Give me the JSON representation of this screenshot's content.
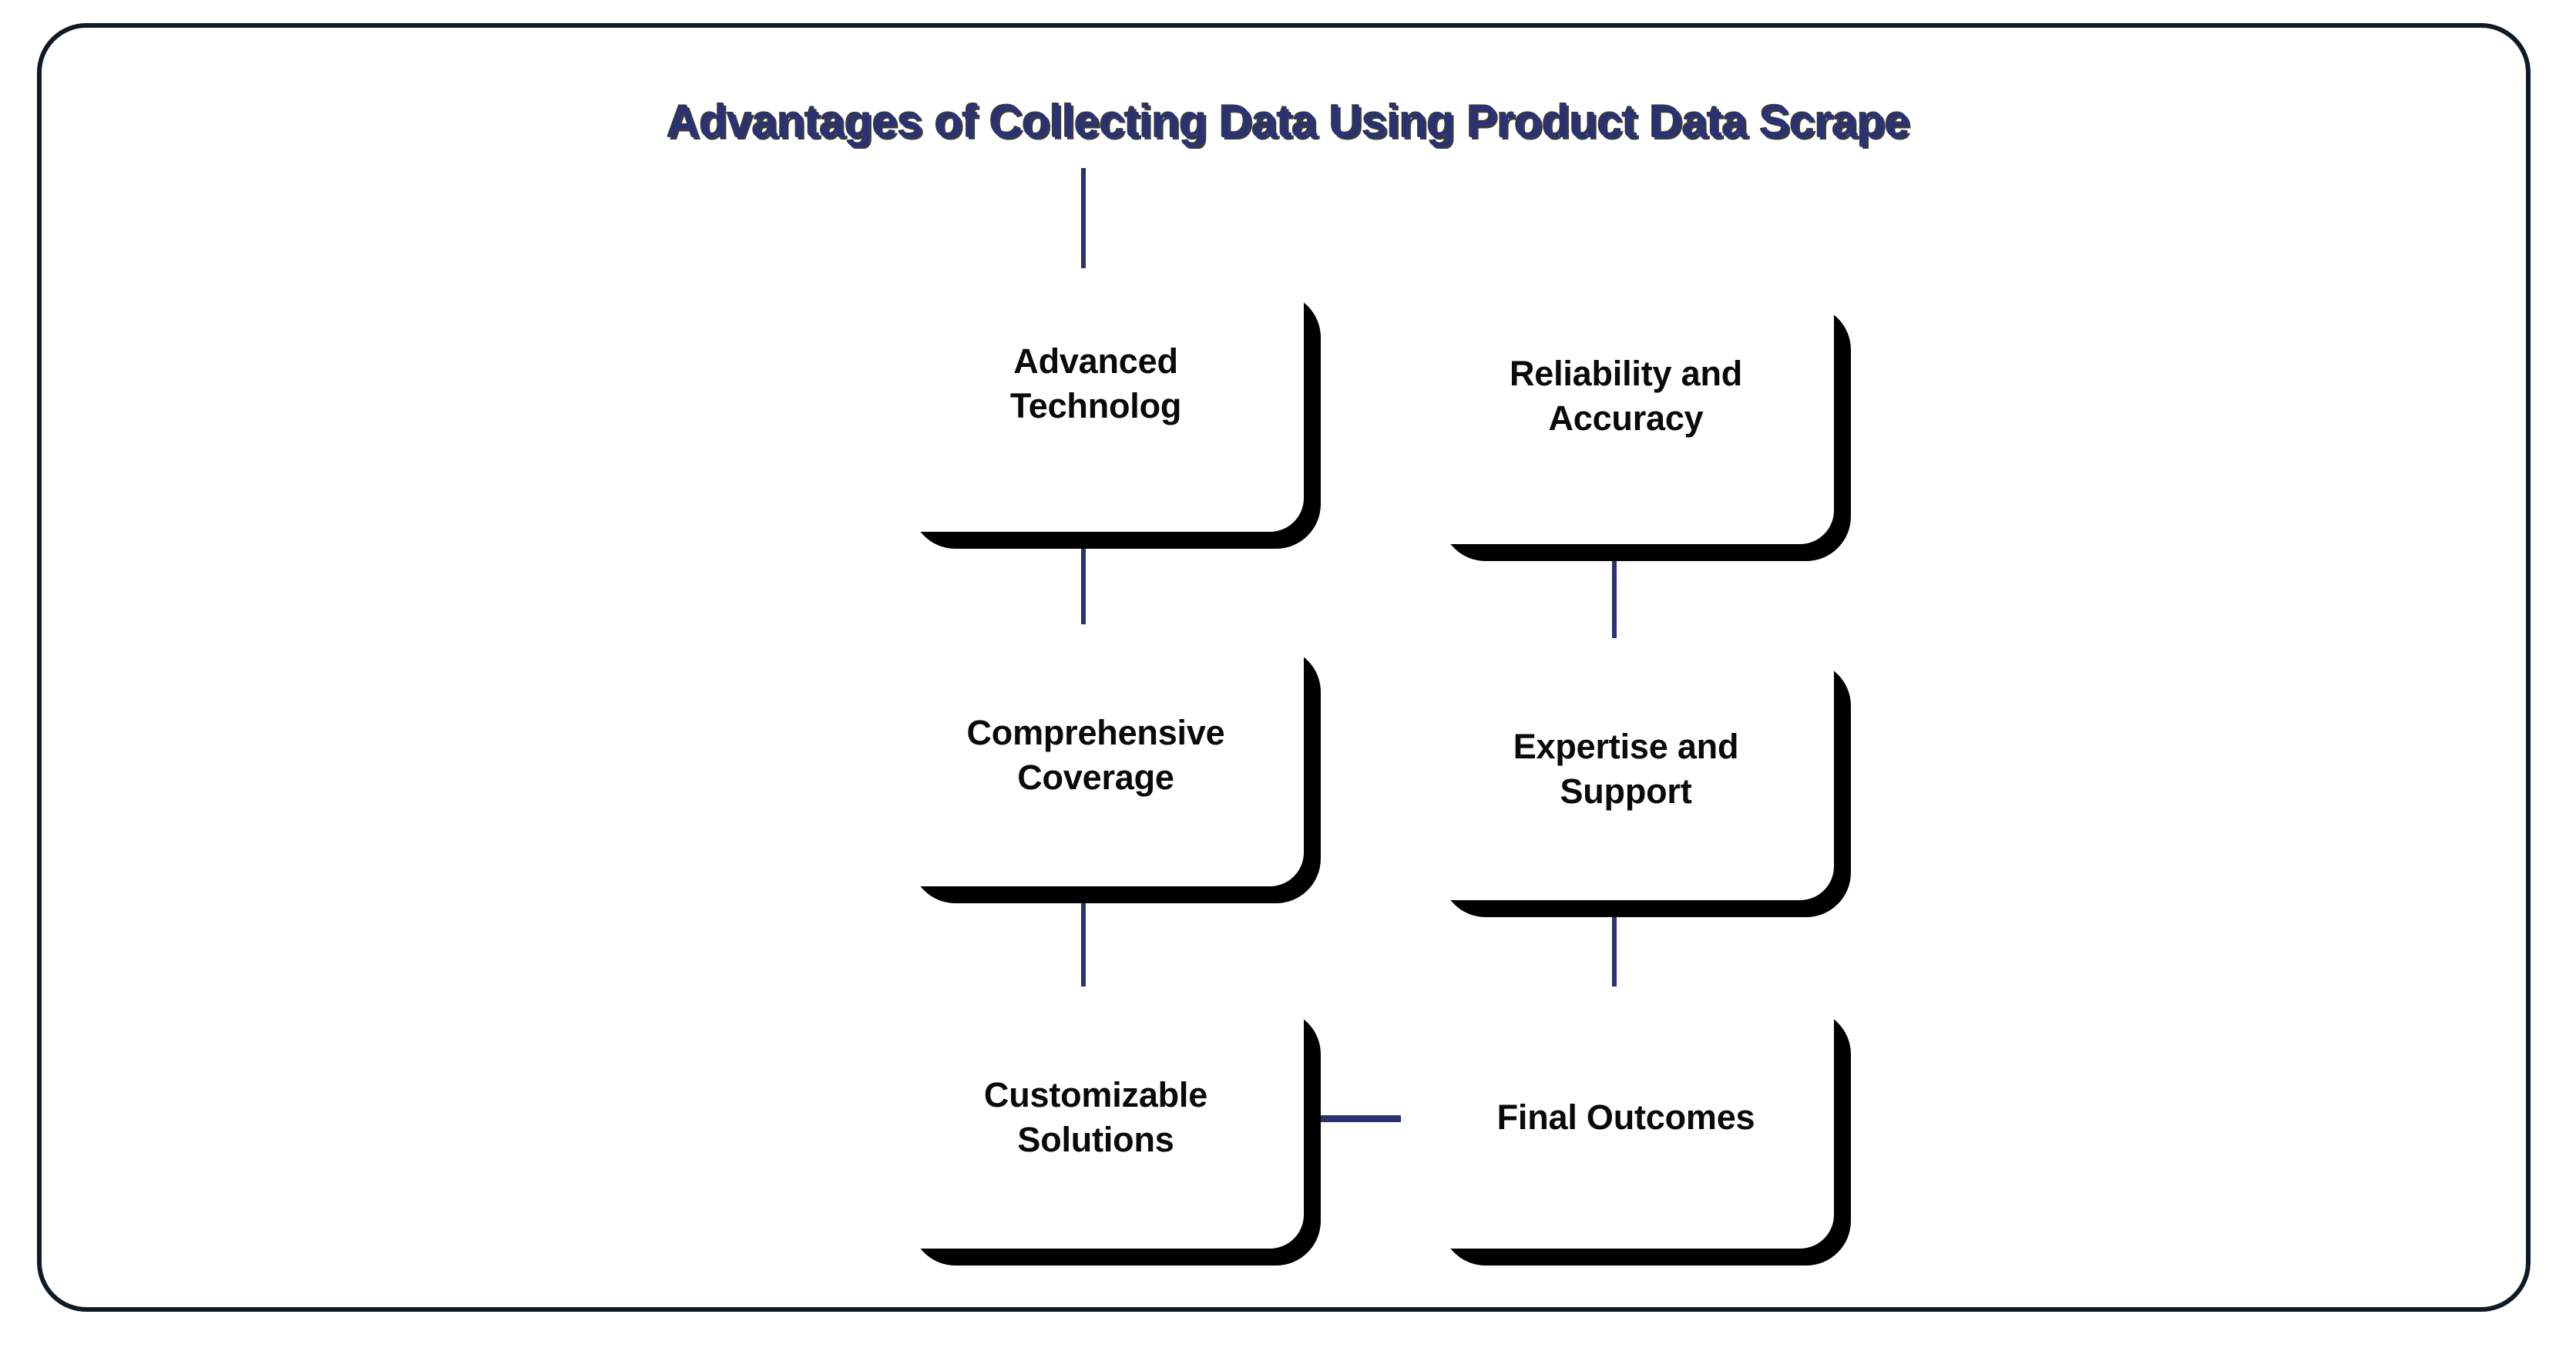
{
  "title": "Advantages of Collecting Data Using Product Data Scrape",
  "colors": {
    "title_text": "#2a3274",
    "title_shadow": "#3a3a3a",
    "connector": "#2b3272",
    "node_shadow": "#000000",
    "node_fill": "#ffffff",
    "node_text": "#0a0a0a",
    "frame_border": "#101a24",
    "background": "#ffffff"
  },
  "nodes": [
    {
      "id": "advanced-technolog",
      "label": "Advanced\nTechnolog",
      "column": "left",
      "row": 1
    },
    {
      "id": "reliability-accuracy",
      "label": "Reliability and\nAccuracy",
      "column": "right",
      "row": 1
    },
    {
      "id": "comprehensive-coverage",
      "label": "Comprehensive\nCoverage",
      "column": "left",
      "row": 2
    },
    {
      "id": "expertise-support",
      "label": "Expertise and\nSupport",
      "column": "right",
      "row": 2
    },
    {
      "id": "customizable-solutions",
      "label": "Customizable\nSolutions",
      "column": "left",
      "row": 3
    },
    {
      "id": "final-outcomes",
      "label": "Final Outcomes",
      "column": "right",
      "row": 3
    }
  ],
  "connectors": [
    {
      "id": "title-to-advanced-technolog",
      "from": "title",
      "to": "advanced-technolog",
      "orientation": "vertical"
    },
    {
      "id": "advanced-technolog-to-comprehensive",
      "from": "advanced-technolog",
      "to": "comprehensive-coverage",
      "orientation": "vertical"
    },
    {
      "id": "comprehensive-to-customizable",
      "from": "comprehensive-coverage",
      "to": "customizable-solutions",
      "orientation": "vertical"
    },
    {
      "id": "reliability-to-expertise",
      "from": "reliability-accuracy",
      "to": "expertise-support",
      "orientation": "vertical"
    },
    {
      "id": "expertise-to-final-outcomes",
      "from": "expertise-support",
      "to": "final-outcomes",
      "orientation": "vertical"
    },
    {
      "id": "customizable-to-final-outcomes",
      "from": "customizable-solutions",
      "to": "final-outcomes",
      "orientation": "horizontal"
    }
  ]
}
